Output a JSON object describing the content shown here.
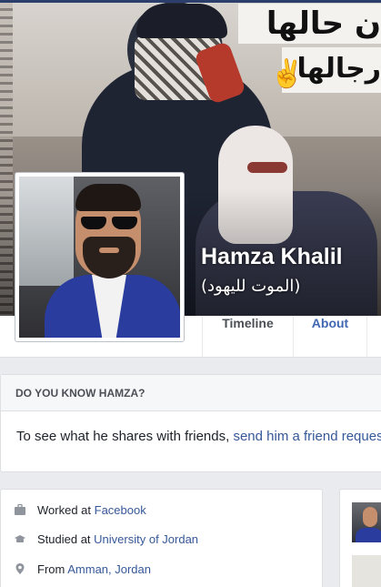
{
  "profile": {
    "name": "Hamza Khalil",
    "alternate_name": "(الموت لليهود)"
  },
  "cover": {
    "banner_line1": "ن حالها",
    "banner_line2": "رجالها"
  },
  "nav": {
    "tabs": [
      {
        "label": "Timeline",
        "active": true
      },
      {
        "label": "About",
        "active": false
      }
    ]
  },
  "know_card": {
    "header": "DO YOU KNOW HAMZA?",
    "text": "To see what he shares with friends, ",
    "link": "send him a friend request."
  },
  "intro": {
    "work": {
      "prefix": "Worked at ",
      "link": "Facebook",
      "icon": "briefcase-icon"
    },
    "study": {
      "prefix": "Studied at ",
      "link": "University of Jordan",
      "icon": "graduation-cap-icon"
    },
    "from": {
      "prefix": "From ",
      "link": "Amman, Jordan",
      "icon": "location-pin-icon"
    }
  },
  "colors": {
    "link": "#365899",
    "nav_active": "#4b4f56",
    "nav_tab": "#4267b2",
    "page_bg": "#e9ebee",
    "icon": "#90949c"
  }
}
